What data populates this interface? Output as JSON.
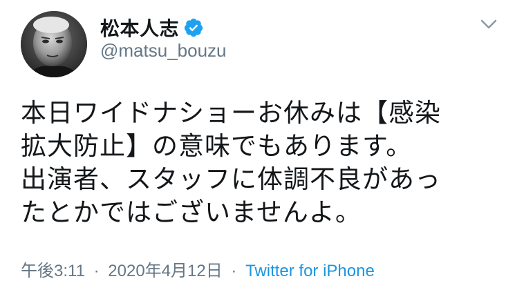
{
  "author": {
    "display_name": "松本人志",
    "handle": "@matsu_bouzu",
    "verified": true
  },
  "icons": {
    "verified": "verified-badge-icon",
    "menu": "chevron-down-icon"
  },
  "tweet": {
    "lines": [
      "本日ワイドナショーお休みは【感染",
      "拡大防止】の意味でもあります。",
      "出演者、スタッフに体調不良があっ",
      "たとかではございませんよ。"
    ]
  },
  "meta": {
    "time": "午後3:11",
    "separator": "·",
    "date": "2020年4月12日",
    "source": "Twitter for iPhone"
  },
  "colors": {
    "text": "#14171a",
    "secondary": "#657786",
    "link": "#1b95e0",
    "verified": "#1da1f2"
  }
}
